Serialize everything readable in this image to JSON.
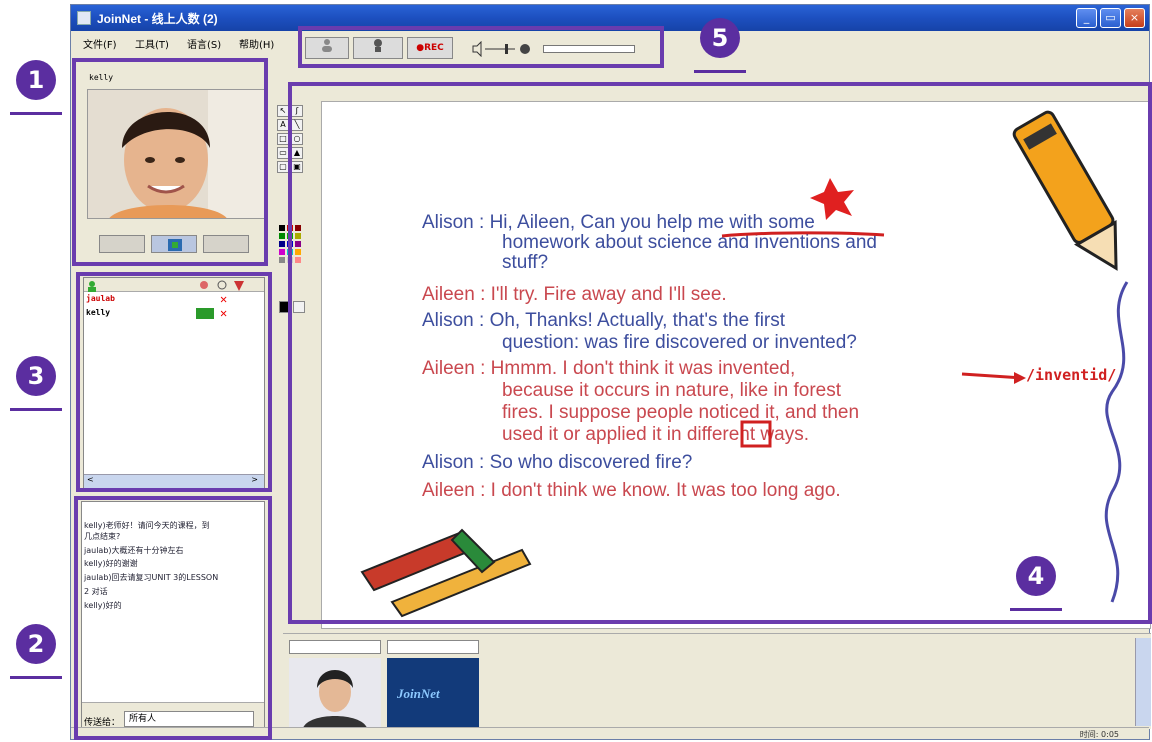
{
  "window": {
    "title": "JoinNet - 线上人数 (2)",
    "buttons": [
      "_",
      "▭",
      "×"
    ]
  },
  "menu": [
    "文件(F)",
    "工具(T)",
    "语言(S)",
    "帮助(H)"
  ],
  "toolbar": {
    "rec_label": "●REC"
  },
  "video": {
    "user_name": "kelly"
  },
  "user_list": {
    "users": [
      {
        "name": "jaulab",
        "color": "#cc0000"
      },
      {
        "name": "kelly",
        "color": "#000000"
      }
    ]
  },
  "chat": {
    "messages": [
      "kelly)老师好！请问今天的课程，到",
      "几点结束?",
      "jaulab)大概还有十分钟左右",
      "kelly)好的谢谢",
      "jaulab)回去请复习UNIT 3的LESSON",
      "2 对话",
      "kelly)好的"
    ],
    "send_label": "传送给：",
    "send_target": "所有人"
  },
  "whiteboard": {
    "dialogue": [
      {
        "text": "Alison : Hi, Aileen, Can you help me with some",
        "speaker": "alison"
      },
      {
        "text": "homework about science and inventions and",
        "speaker": "alison"
      },
      {
        "text": "stuff?",
        "speaker": "alison"
      },
      {
        "text": "Aileen : I'll try. Fire away and I'll see.",
        "speaker": "aileen"
      },
      {
        "text": "Alison : Oh, Thanks! Actually, that's the first",
        "speaker": "alison"
      },
      {
        "text": "question: was fire discovered or invented?",
        "speaker": "alison"
      },
      {
        "text": "Aileen : Hmmm. I don't think it was invented,",
        "speaker": "aileen"
      },
      {
        "text": "because it occurs in nature, like in forest",
        "speaker": "aileen"
      },
      {
        "text": "fires. I suppose people noticed it, and then",
        "speaker": "aileen"
      },
      {
        "text": "used it or applied it in different ways.",
        "speaker": "aileen"
      },
      {
        "text": "Alison : So who discovered fire?",
        "speaker": "alison"
      },
      {
        "text": "Aileen : I don't think we know. It was too long ago.",
        "speaker": "aileen"
      }
    ],
    "annotation_text": "/inventid/"
  },
  "thumbnails": {
    "logo_text": "JoinNet"
  },
  "status": {
    "time": "时间: 0:05"
  },
  "markers": [
    "1",
    "2",
    "3",
    "4",
    "5"
  ],
  "colors": {
    "annotation_purple": "#6a3cae",
    "alison_blue": "#3d4e9e",
    "aileen_red": "#c9484f",
    "titlebar_blue": "#1d4fbf"
  }
}
